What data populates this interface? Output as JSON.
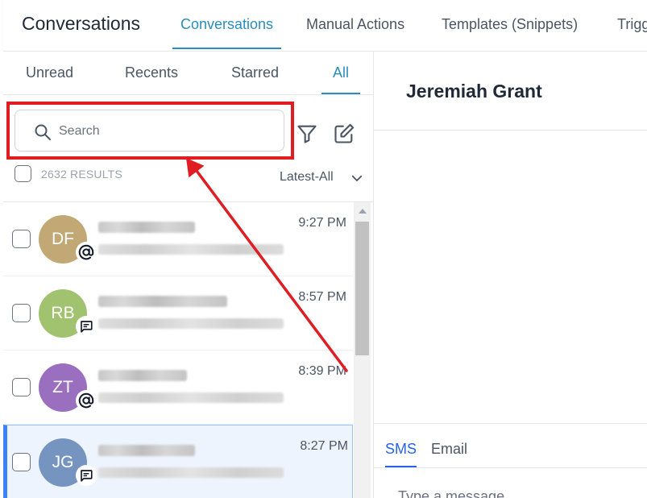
{
  "header": {
    "app_title": "Conversations",
    "tabs": [
      {
        "label": "Conversations",
        "active": true
      },
      {
        "label": "Manual Actions",
        "active": false
      },
      {
        "label": "Templates (Snippets)",
        "active": false
      },
      {
        "label": "Trigg",
        "active": false
      }
    ]
  },
  "filters": {
    "tabs": [
      {
        "label": "Unread",
        "active": false
      },
      {
        "label": "Recents",
        "active": false
      },
      {
        "label": "Starred",
        "active": false
      },
      {
        "label": "All",
        "active": true
      }
    ]
  },
  "search": {
    "placeholder": "Search",
    "value": ""
  },
  "toolbar": {
    "filter_icon": "filter-icon",
    "compose_icon": "compose-icon"
  },
  "list_meta": {
    "results": "2632 RESULTS",
    "sort": "Latest-All"
  },
  "conversations": [
    {
      "initials": "DF",
      "avatar_color": "#c1a874",
      "channel": "email",
      "channel_icon": "at-sign-icon",
      "time": "9:27 PM",
      "selected": false
    },
    {
      "initials": "RB",
      "avatar_color": "#a1c26f",
      "channel": "sms",
      "channel_icon": "message-icon",
      "time": "8:57 PM",
      "selected": false
    },
    {
      "initials": "ZT",
      "avatar_color": "#9b6fbf",
      "channel": "email",
      "channel_icon": "at-sign-icon",
      "time": "8:39 PM",
      "selected": false
    },
    {
      "initials": "JG",
      "avatar_color": "#7595c0",
      "channel": "sms",
      "channel_icon": "message-icon",
      "time": "8:27 PM",
      "selected": true
    }
  ],
  "contact": {
    "name": "Jeremiah Grant"
  },
  "composer": {
    "tabs": [
      {
        "label": "SMS",
        "active": true
      },
      {
        "label": "Email",
        "active": false
      }
    ],
    "placeholder": "Type a message"
  },
  "colors": {
    "accent": "#2a8ebd",
    "annotation": "#e11d24",
    "selected_row": "#eef4fd"
  }
}
